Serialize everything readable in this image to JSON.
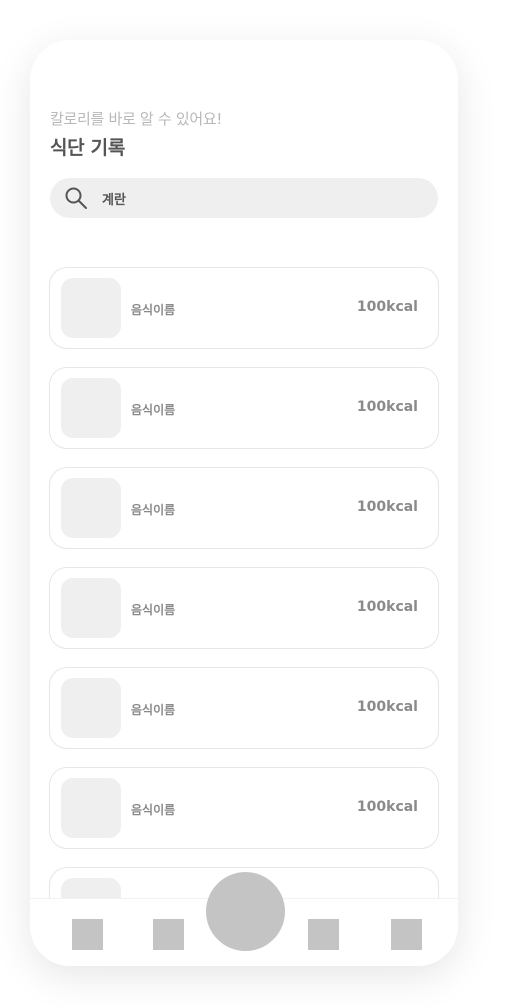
{
  "header": {
    "subtitle": "칼로리를 바로 알 수 있어요!",
    "title": "식단 기록"
  },
  "search": {
    "icon": "search-icon",
    "value": "계란"
  },
  "food_list": [
    {
      "name": "음식이름",
      "calories": "100kcal"
    },
    {
      "name": "음식이름",
      "calories": "100kcal"
    },
    {
      "name": "음식이름",
      "calories": "100kcal"
    },
    {
      "name": "음식이름",
      "calories": "100kcal"
    },
    {
      "name": "음식이름",
      "calories": "100kcal"
    },
    {
      "name": "음식이름",
      "calories": "100kcal"
    },
    {
      "name": "",
      "calories": ""
    }
  ],
  "colors": {
    "placeholder_gray": "#c4c4c4",
    "thumb_gray": "#efefef",
    "text_gray": "#8a8a8a"
  }
}
